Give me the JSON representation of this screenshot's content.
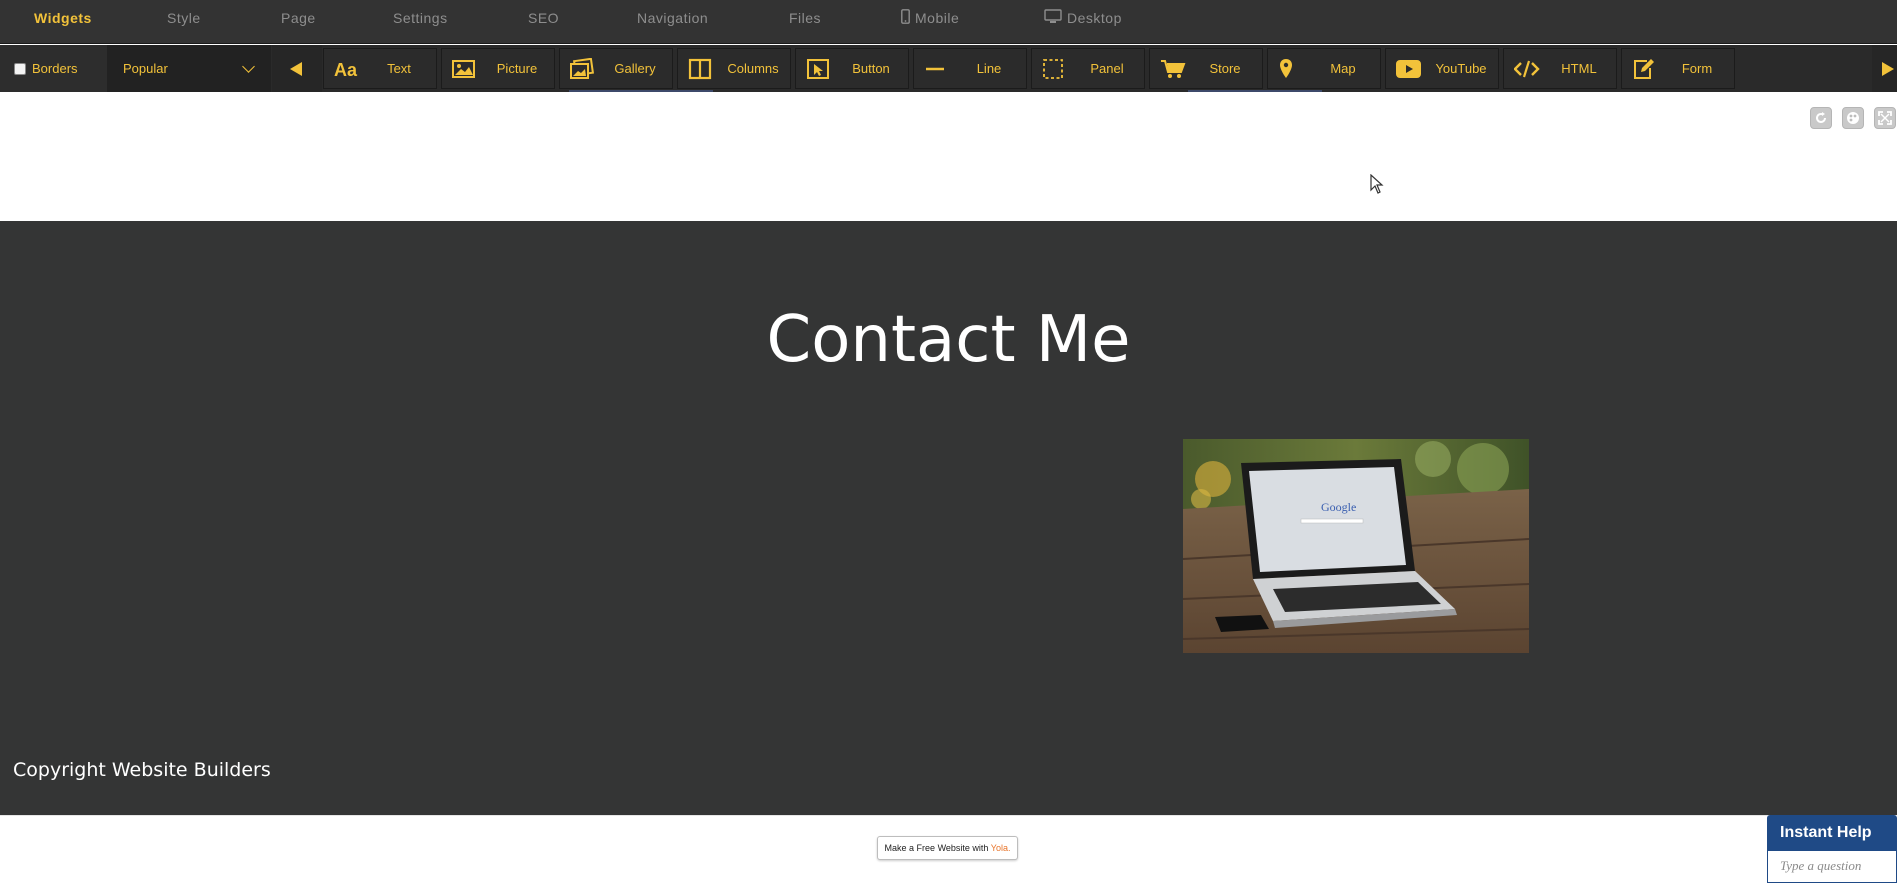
{
  "tabs": [
    {
      "label": "Widgets",
      "active": true
    },
    {
      "label": "Style"
    },
    {
      "label": "Page"
    },
    {
      "label": "Settings"
    },
    {
      "label": "SEO"
    },
    {
      "label": "Navigation"
    },
    {
      "label": "Files"
    },
    {
      "label": "Mobile",
      "icon": "mobile-icon"
    },
    {
      "label": "Desktop",
      "icon": "desktop-icon"
    }
  ],
  "toolbar": {
    "borders_label": "Borders",
    "category_selected": "Popular",
    "widgets": [
      {
        "label": "Text",
        "icon": "text-icon"
      },
      {
        "label": "Picture",
        "icon": "picture-icon"
      },
      {
        "label": "Gallery",
        "icon": "gallery-icon"
      },
      {
        "label": "Columns",
        "icon": "columns-icon"
      },
      {
        "label": "Button",
        "icon": "button-icon"
      },
      {
        "label": "Line",
        "icon": "line-icon"
      },
      {
        "label": "Panel",
        "icon": "panel-icon"
      },
      {
        "label": "Store",
        "icon": "cart-icon"
      },
      {
        "label": "Map",
        "icon": "map-pin-icon"
      },
      {
        "label": "YouTube",
        "icon": "youtube-icon"
      },
      {
        "label": "HTML",
        "icon": "code-icon"
      },
      {
        "label": "Form",
        "icon": "form-icon"
      }
    ]
  },
  "page": {
    "heading": "Contact Me",
    "copyright": "Copyright Website Builders"
  },
  "footer": {
    "badge_prefix": "Make a Free Website with ",
    "badge_brand": "Yola."
  },
  "help": {
    "title": "Instant Help",
    "placeholder": "Type a question"
  },
  "colors": {
    "accent": "#f2c23a",
    "toolbar_bg": "#2a2a2a",
    "section_bg": "#343535",
    "help_blue": "#1f4a86"
  }
}
